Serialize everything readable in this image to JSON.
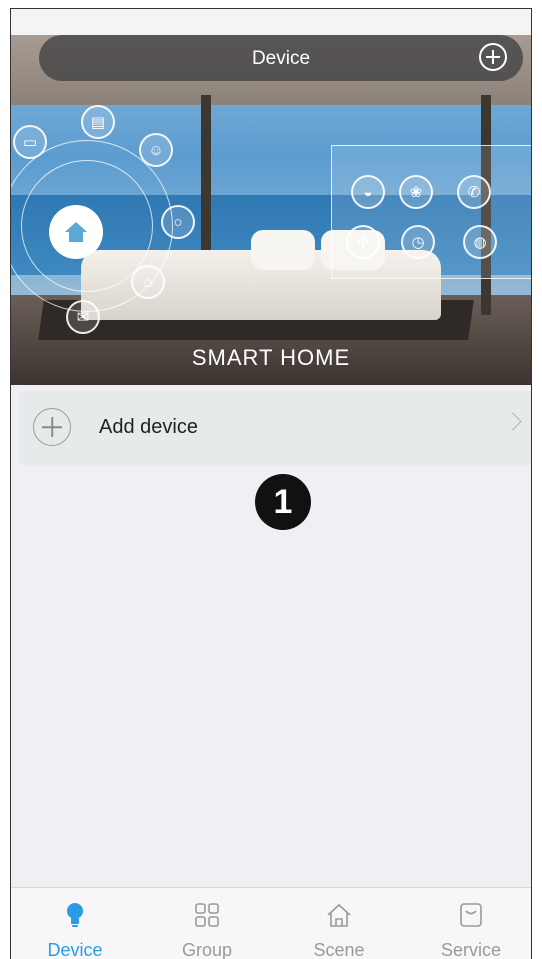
{
  "header": {
    "title": "Device",
    "add_icon": "plus-circle-icon"
  },
  "banner": {
    "text": "SMART HOME"
  },
  "device_list": {
    "add_label": "Add device",
    "add_icon": "plus-circle-icon",
    "chevron_icon": "chevron-right-icon"
  },
  "callout": {
    "number": "1"
  },
  "tabbar": {
    "tabs": [
      {
        "label": "Device",
        "icon": "bulb-icon",
        "active": true
      },
      {
        "label": "Group",
        "icon": "grid-icon",
        "active": false
      },
      {
        "label": "Scene",
        "icon": "house-icon",
        "active": false
      },
      {
        "label": "Service",
        "icon": "bag-icon",
        "active": false
      }
    ]
  },
  "colors": {
    "accent": "#2b9be8",
    "background": "#efeff4",
    "row_background": "#e7eaeb"
  }
}
